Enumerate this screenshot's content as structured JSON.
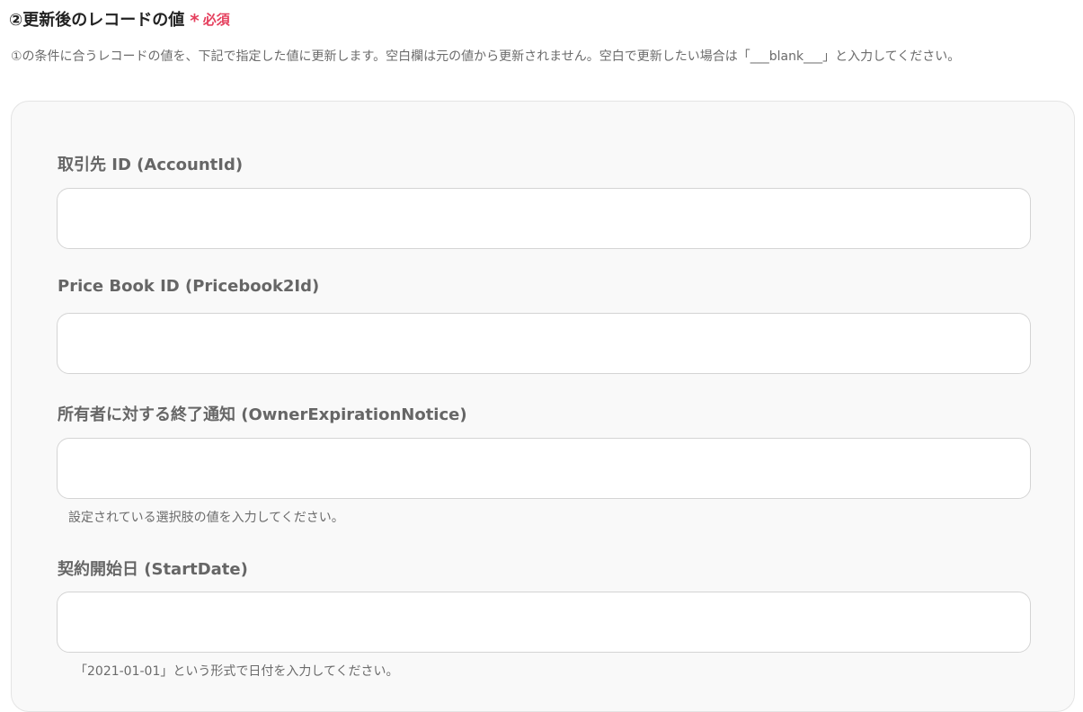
{
  "section": {
    "title": "②更新後のレコードの値",
    "required_mark": "*",
    "required_label": "必須",
    "description": "①の条件に合うレコードの値を、下記で指定した値に更新します。空白欄は元の値から更新されません。空白で更新したい場合は「___blank___」と入力してください。"
  },
  "fields": [
    {
      "label": "取引先 ID (AccountId)",
      "value": "",
      "placeholder": "",
      "help": ""
    },
    {
      "label": "Price Book ID (Pricebook2Id)",
      "value": "",
      "placeholder": "",
      "help": ""
    },
    {
      "label": "所有者に対する終了通知 (OwnerExpirationNotice)",
      "value": "",
      "placeholder": "",
      "help": "設定されている選択肢の値を入力してください。"
    },
    {
      "label": "契約開始日 (StartDate)",
      "value": "",
      "placeholder": "",
      "help": "「2021-01-01」という形式で日付を入力してください。"
    }
  ]
}
